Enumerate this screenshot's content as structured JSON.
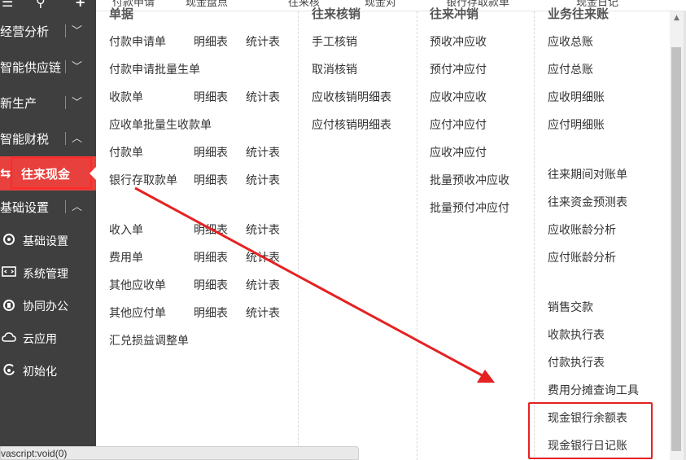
{
  "topbar": {
    "fragments": [
      "付款申请",
      "现金盘点",
      "往来核",
      "现金对",
      "银行存取款单",
      "现金日记"
    ]
  },
  "sidebar": {
    "top_icons": [
      "menu-icon",
      "search-icon",
      "plus-icon"
    ],
    "groups": [
      {
        "label": "经营分析",
        "expanded": false
      },
      {
        "label": "智能供应链",
        "expanded": false
      },
      {
        "label": "新生产",
        "expanded": false
      },
      {
        "label": "智能财税",
        "expanded": true
      }
    ],
    "active_item": {
      "label": "往来现金",
      "icon": "exchange-icon"
    },
    "settings_group": {
      "label": "基础设置",
      "expanded": true
    },
    "sub_items": [
      {
        "label": "基础设置",
        "icon": "camera-gear-icon"
      },
      {
        "label": "系统管理",
        "icon": "code-monitor-icon"
      },
      {
        "label": "协同办公",
        "icon": "radio-icon"
      },
      {
        "label": "云应用",
        "icon": "cloud-icon"
      },
      {
        "label": "初始化",
        "icon": "refresh-c-icon"
      }
    ]
  },
  "statusbar": {
    "text": "vascript:void(0)"
  },
  "columns": {
    "col1": {
      "header": "单据",
      "rows": [
        {
          "name": "付款申请单",
          "detail": "明细表",
          "stats": "统计表"
        },
        {
          "name": "付款申请批量生单"
        },
        {
          "name": "收款单",
          "detail": "明细表",
          "stats": "统计表"
        },
        {
          "name": "应收单批量生收款单"
        },
        {
          "name": "付款单",
          "detail": "明细表",
          "stats": "统计表"
        },
        {
          "name": "银行存取款单",
          "detail": "明细表",
          "stats": "统计表"
        },
        {
          "name": "收入单",
          "detail": "明细表",
          "stats": "统计表"
        },
        {
          "name": "费用单",
          "detail": "明细表",
          "stats": "统计表"
        },
        {
          "name": "其他应收单",
          "detail": "明细表",
          "stats": "统计表"
        },
        {
          "name": "其他应付单",
          "detail": "明细表",
          "stats": "统计表"
        },
        {
          "name": "汇兑损益调整单"
        }
      ]
    },
    "col2": {
      "header": "往来核销",
      "items": [
        "手工核销",
        "取消核销",
        "应收核销明细表",
        "应付核销明细表"
      ]
    },
    "col3": {
      "header": "往来冲销",
      "items": [
        "预收冲应收",
        "预付冲应付",
        "应收冲应收",
        "应付冲应付",
        "应收冲应付",
        "批量预收冲应收",
        "批量预付冲应付"
      ]
    },
    "col4": {
      "header": "业务往来账",
      "items": [
        "应收总账",
        "应付总账",
        "应收明细账",
        "应付明细账",
        "往来期间对账单",
        "往来资金预测表",
        "应收账龄分析",
        "应付账龄分析",
        "销售交款",
        "收款执行表",
        "付款执行表",
        "费用分摊查询工具",
        "现金银行余额表",
        "现金银行日记账"
      ]
    }
  },
  "colors": {
    "sidebar_bg": "#3f3f3f",
    "active_bg": "#e8403d",
    "highlight": "#e52222",
    "arrow": "#e52222"
  }
}
